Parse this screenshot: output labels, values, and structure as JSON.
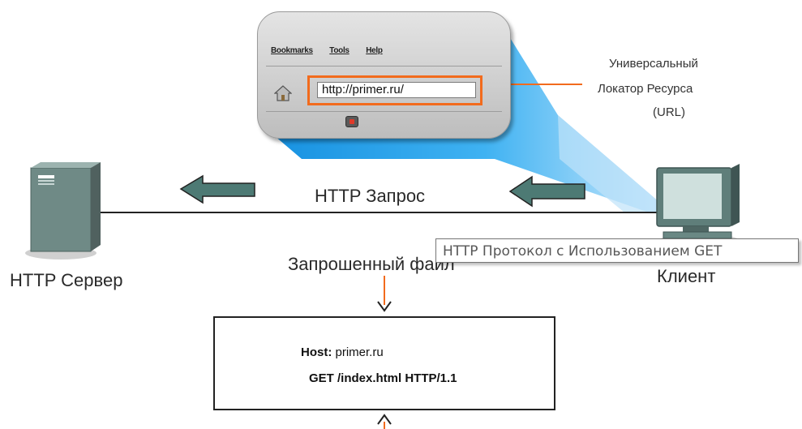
{
  "browser": {
    "menu": [
      "Bookmarks",
      "Tools",
      "Help"
    ],
    "url": "http://primer.ru/"
  },
  "url_label": {
    "line1": "Универсальный",
    "line2": "Локатор Ресурса",
    "line3": "(URL)"
  },
  "request_label": "HTTP Запрос",
  "server_label": "HTTP Сервер",
  "client_label": "Клиент",
  "requested_file_label": "Запрошенный файл",
  "tooltip": "HTTP Протокол с Использованием GET",
  "request": {
    "host_key": "Host:",
    "host_value": "primer.ru",
    "get_line": "GET /index.html HTTP/1.1"
  },
  "colors": {
    "accent_orange": "#f26b1d",
    "beam_blue": "#1ea9f0",
    "arrow_fill": "#4d7a74"
  },
  "icons": [
    "server-icon",
    "client-computer-icon",
    "home-icon",
    "stop-icon"
  ]
}
